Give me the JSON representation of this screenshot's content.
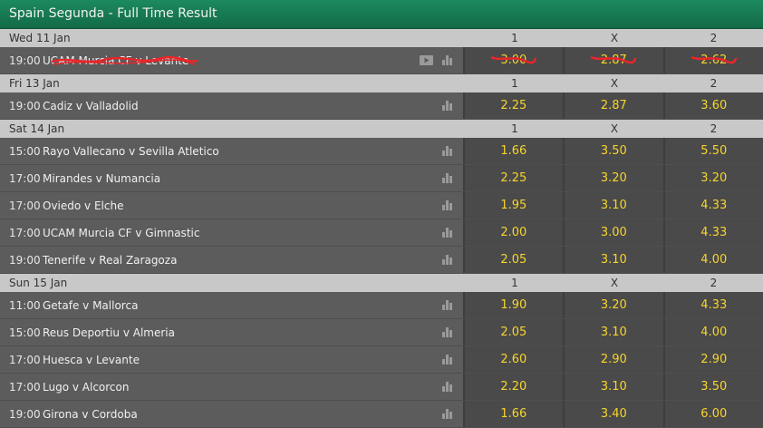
{
  "header": {
    "title": "Spain Segunda - Full Time Result"
  },
  "columns": {
    "home": "1",
    "draw": "X",
    "away": "2"
  },
  "days": [
    {
      "label": "Wed 11 Jan",
      "matches": [
        {
          "time": "19:00",
          "name": "UCAM Murcia CF v Levante",
          "odds": [
            "3.00",
            "2.87",
            "2.62"
          ],
          "has_video": true,
          "crossed_out": true
        }
      ]
    },
    {
      "label": "Fri 13 Jan",
      "matches": [
        {
          "time": "19:00",
          "name": "Cadiz v Valladolid",
          "odds": [
            "2.25",
            "2.87",
            "3.60"
          ]
        }
      ]
    },
    {
      "label": "Sat 14 Jan",
      "matches": [
        {
          "time": "15:00",
          "name": "Rayo Vallecano v Sevilla Atletico",
          "odds": [
            "1.66",
            "3.50",
            "5.50"
          ]
        },
        {
          "time": "17:00",
          "name": "Mirandes v Numancia",
          "odds": [
            "2.25",
            "3.20",
            "3.20"
          ]
        },
        {
          "time": "17:00",
          "name": "Oviedo v Elche",
          "odds": [
            "1.95",
            "3.10",
            "4.33"
          ]
        },
        {
          "time": "17:00",
          "name": "UCAM Murcia CF v Gimnastic",
          "odds": [
            "2.00",
            "3.00",
            "4.33"
          ]
        },
        {
          "time": "19:00",
          "name": "Tenerife v Real Zaragoza",
          "odds": [
            "2.05",
            "3.10",
            "4.00"
          ]
        }
      ]
    },
    {
      "label": "Sun 15 Jan",
      "matches": [
        {
          "time": "11:00",
          "name": "Getafe v Mallorca",
          "odds": [
            "1.90",
            "3.20",
            "4.33"
          ]
        },
        {
          "time": "15:00",
          "name": "Reus Deportiu v Almeria",
          "odds": [
            "2.05",
            "3.10",
            "4.00"
          ]
        },
        {
          "time": "17:00",
          "name": "Huesca v Levante",
          "odds": [
            "2.60",
            "2.90",
            "2.90"
          ]
        },
        {
          "time": "17:00",
          "name": "Lugo v Alcorcon",
          "odds": [
            "2.20",
            "3.10",
            "3.50"
          ]
        },
        {
          "time": "19:00",
          "name": "Girona v Cordoba",
          "odds": [
            "1.66",
            "3.40",
            "6.00"
          ]
        }
      ]
    }
  ],
  "icons": {
    "stats": "bar-chart-icon",
    "video": "play-video-icon"
  },
  "colors": {
    "header_bg": "#17784f",
    "odds_text": "#f7d42c",
    "day_bar": "#c8c8c8",
    "scribble": "#e8262a"
  }
}
